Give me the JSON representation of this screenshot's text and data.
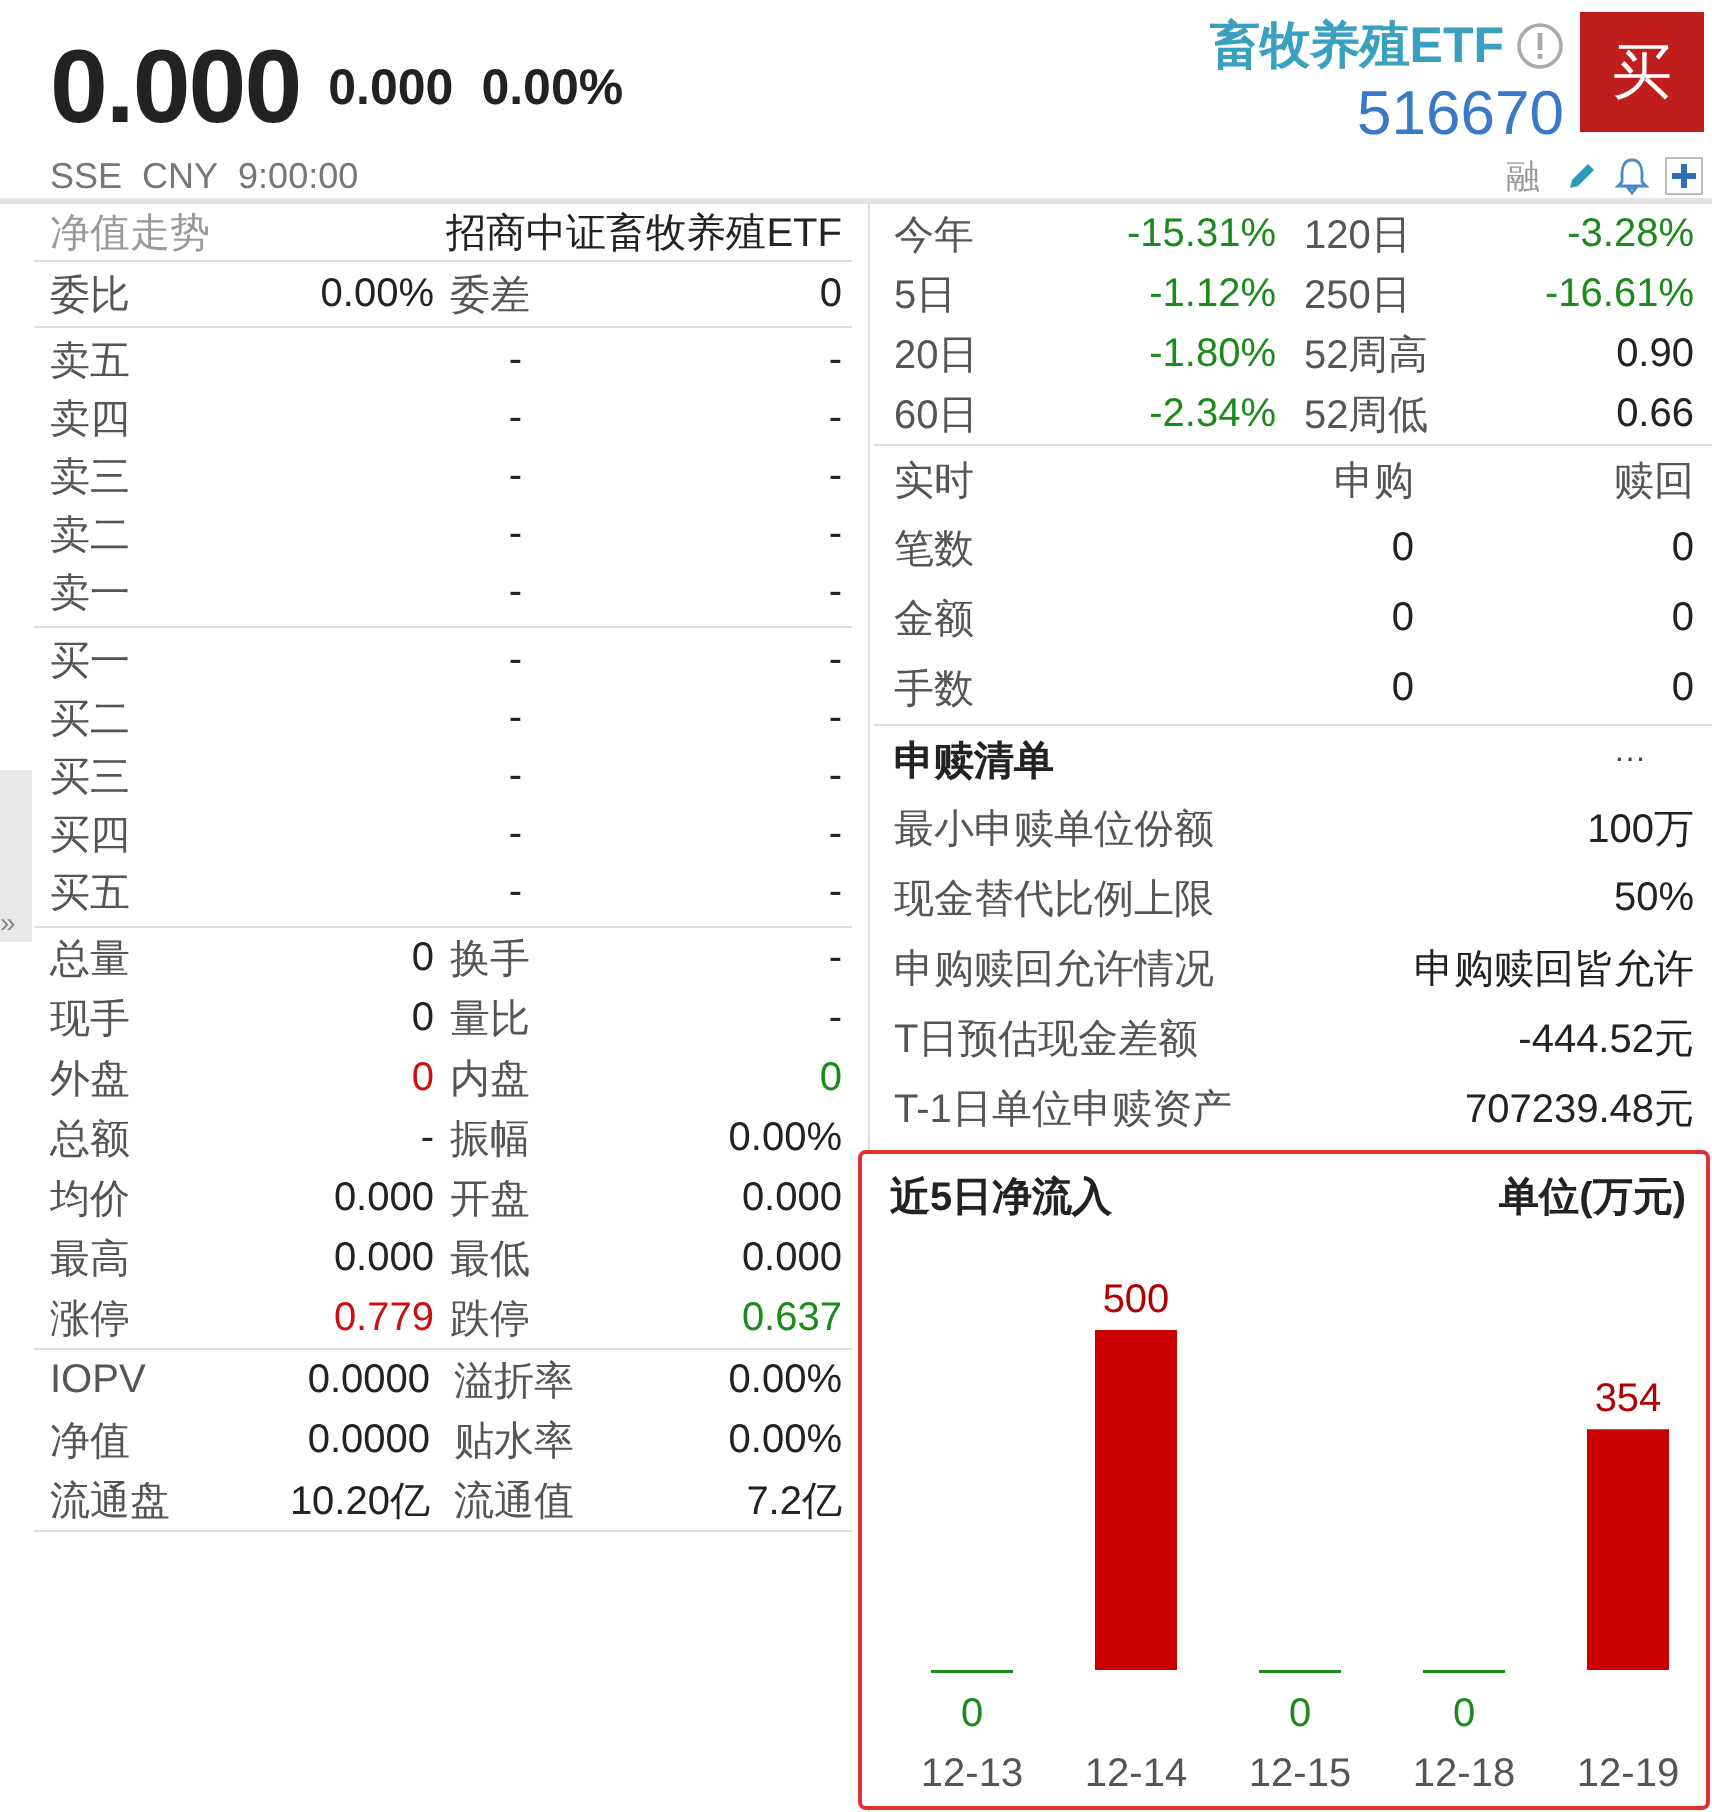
{
  "header": {
    "price": "0.000",
    "change": "0.000",
    "change_pct": "0.00%",
    "name": "畜牧养殖ETF",
    "code": "516670",
    "buy_button": "买",
    "exchange": "SSE",
    "currency": "CNY",
    "time": "9:00:00",
    "margin_tag": "融"
  },
  "expand_handle": "»",
  "left": {
    "nav_row": {
      "label": "净值走势",
      "value": "招商中证畜牧养殖ETF"
    },
    "commission": [
      {
        "label": "委比",
        "value": "0.00%"
      },
      {
        "label": "委差",
        "value": "0"
      }
    ],
    "asks": [
      {
        "label": "卖五",
        "price": "-",
        "volume": "-"
      },
      {
        "label": "卖四",
        "price": "-",
        "volume": "-"
      },
      {
        "label": "卖三",
        "price": "-",
        "volume": "-"
      },
      {
        "label": "卖二",
        "price": "-",
        "volume": "-"
      },
      {
        "label": "卖一",
        "price": "-",
        "volume": "-"
      }
    ],
    "bids": [
      {
        "label": "买一",
        "price": "-",
        "volume": "-"
      },
      {
        "label": "买二",
        "price": "-",
        "volume": "-"
      },
      {
        "label": "买三",
        "price": "-",
        "volume": "-"
      },
      {
        "label": "买四",
        "price": "-",
        "volume": "-"
      },
      {
        "label": "买五",
        "price": "-",
        "volume": "-"
      }
    ],
    "stats": [
      [
        {
          "label": "总量",
          "value": "0",
          "color": "#222222"
        },
        {
          "label": "换手",
          "value": "-",
          "color": "#222222"
        }
      ],
      [
        {
          "label": "现手",
          "value": "0",
          "color": "#222222"
        },
        {
          "label": "量比",
          "value": "-",
          "color": "#222222"
        }
      ],
      [
        {
          "label": "外盘",
          "value": "0",
          "color": "#cc1010"
        },
        {
          "label": "内盘",
          "value": "0",
          "color": "#1a8a1a"
        }
      ],
      [
        {
          "label": "总额",
          "value": "-",
          "color": "#222222"
        },
        {
          "label": "振幅",
          "value": "0.00%",
          "color": "#222222"
        }
      ],
      [
        {
          "label": "均价",
          "value": "0.000",
          "color": "#222222"
        },
        {
          "label": "开盘",
          "value": "0.000",
          "color": "#222222"
        }
      ],
      [
        {
          "label": "最高",
          "value": "0.000",
          "color": "#222222"
        },
        {
          "label": "最低",
          "value": "0.000",
          "color": "#222222"
        }
      ],
      [
        {
          "label": "涨停",
          "value": "0.779",
          "color": "#cc1010"
        },
        {
          "label": "跌停",
          "value": "0.637",
          "color": "#1a8a1a"
        }
      ]
    ],
    "etf_stats": [
      [
        {
          "label": "IOPV",
          "value": "0.0000",
          "color": "#222222"
        },
        {
          "label": "溢折率",
          "value": "0.00%",
          "color": "#222222"
        }
      ],
      [
        {
          "label": "净值",
          "value": "0.0000",
          "color": "#222222"
        },
        {
          "label": "贴水率",
          "value": "0.00%",
          "color": "#222222"
        }
      ],
      [
        {
          "label": "流通盘",
          "value": "10.20亿",
          "color": "#222222"
        },
        {
          "label": "流通值",
          "value": "7.2亿",
          "color": "#222222"
        }
      ]
    ]
  },
  "right": {
    "returns": [
      [
        {
          "label": "今年",
          "value": "-15.31%",
          "color": "#1a8a1a"
        },
        {
          "label": "120日",
          "value": "-3.28%",
          "color": "#1a8a1a"
        }
      ],
      [
        {
          "label": "5日",
          "value": "-1.12%",
          "color": "#1a8a1a"
        },
        {
          "label": "250日",
          "value": "-16.61%",
          "color": "#1a8a1a"
        }
      ],
      [
        {
          "label": "20日",
          "value": "-1.80%",
          "color": "#1a8a1a"
        },
        {
          "label": "52周高",
          "value": "0.90",
          "color": "#222222"
        }
      ],
      [
        {
          "label": "60日",
          "value": "-2.34%",
          "color": "#1a8a1a"
        },
        {
          "label": "52周低",
          "value": "0.66",
          "color": "#222222"
        }
      ]
    ],
    "realtime": {
      "columns": [
        "实时",
        "申购",
        "赎回"
      ],
      "rows": [
        {
          "label": "笔数",
          "subscribe": "0",
          "redeem": "0"
        },
        {
          "label": "金额",
          "subscribe": "0",
          "redeem": "0"
        },
        {
          "label": "手数",
          "subscribe": "0",
          "redeem": "0"
        }
      ]
    },
    "creation_list": {
      "title": "申赎清单",
      "more": "···",
      "items": [
        {
          "label": "最小申赎单位份额",
          "value": "100万"
        },
        {
          "label": "现金替代比例上限",
          "value": "50%"
        },
        {
          "label": "申购赎回允许情况",
          "value": "申购赎回皆允许"
        },
        {
          "label": "T日预估现金差额",
          "value": "-444.52元"
        },
        {
          "label": "T-1日单位申赎资产",
          "value": "707239.48元"
        }
      ]
    },
    "net_inflow": {
      "title": "近5日净流入",
      "unit": "单位(万元)",
      "chart_data": {
        "type": "bar",
        "categories": [
          "12-13",
          "12-14",
          "12-15",
          "12-18",
          "12-19"
        ],
        "values": [
          0,
          500,
          0,
          0,
          354
        ],
        "data_labels": true
      }
    }
  }
}
